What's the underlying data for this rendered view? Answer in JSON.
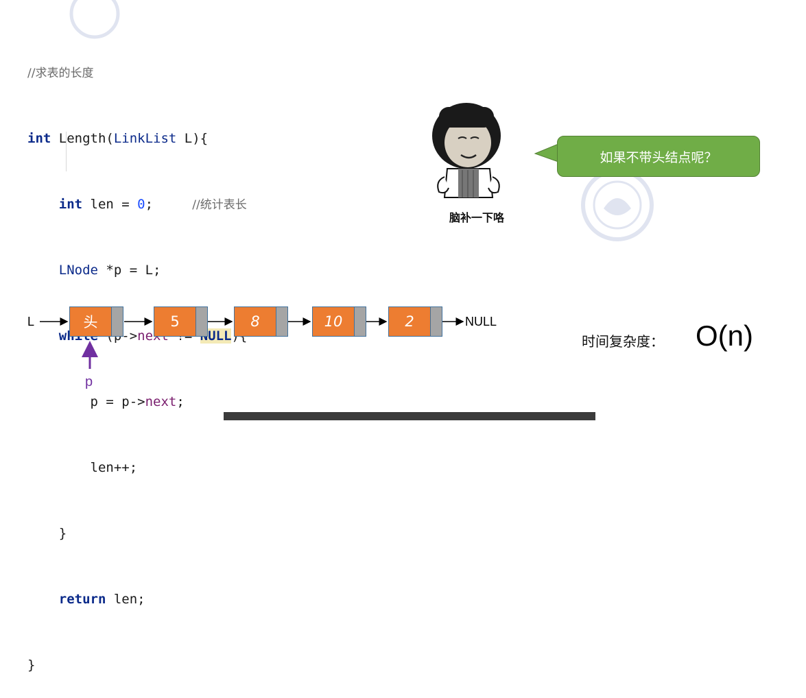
{
  "code": {
    "comment_title": "//求表的长度",
    "kw_int": "int",
    "fn_sig": " Length(",
    "type_linklist": "LinkList",
    "fn_sig_end": " L){",
    "kw_int2": "int",
    "len_decl": " len = ",
    "zero": "0",
    "semicolon": ";",
    "comment_len": "//统计表长",
    "type_lnode": "LNode",
    "lnode_rest": " *p = L;",
    "kw_while": "while",
    "while_open": " (p->",
    "field_next": "next",
    "ne": " != ",
    "null_kw": "NULL",
    "while_close": "){",
    "assign_p": "p = p->",
    "field_next2": "next",
    "semicolon2": ";",
    "len_inc": "len++;",
    "brace_close_inner": "}",
    "kw_return": "return",
    "return_rest": " len;",
    "brace_close_outer": "}"
  },
  "meme": {
    "caption": "脑补一下咯",
    "bubble_text": "如果不带头结点呢？"
  },
  "linked_list": {
    "head_label": "L",
    "nodes": [
      {
        "value": "头",
        "italic": false
      },
      {
        "value": "5",
        "italic": false
      },
      {
        "value": "8",
        "italic": true
      },
      {
        "value": "10",
        "italic": true
      },
      {
        "value": "2",
        "italic": true
      }
    ],
    "null_label": "NULL",
    "pointer_label": "p"
  },
  "complexity": {
    "label": "时间复杂度：",
    "value": "O(n)"
  },
  "colors": {
    "node_fill": "#ed7d31",
    "pointer_cell": "#a5a5a5",
    "bubble": "#70ad47",
    "pointer_arrow": "#7030a0",
    "keyword": "#0b2a8a"
  }
}
